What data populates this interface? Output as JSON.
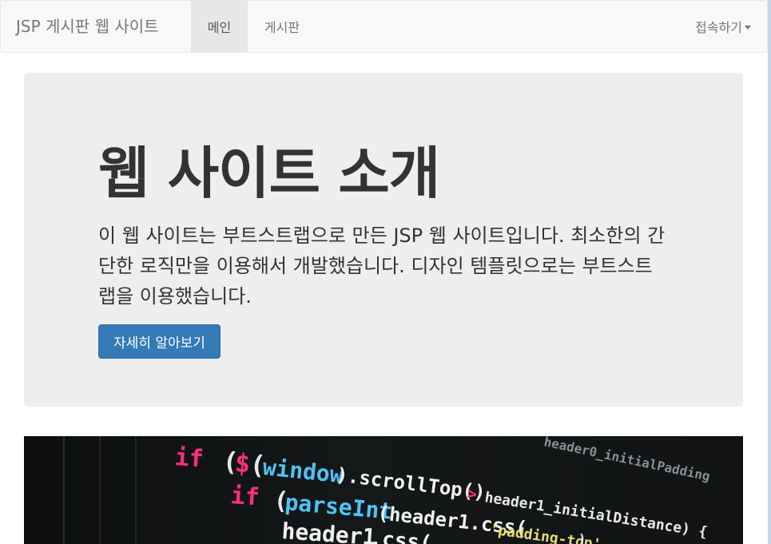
{
  "navbar": {
    "brand": "JSP 게시판 웹 사이트",
    "items": [
      {
        "label": "메인",
        "active": true
      },
      {
        "label": "게시판",
        "active": false
      }
    ],
    "dropdown": {
      "label": "접속하기"
    }
  },
  "jumbotron": {
    "title": "웹 사이트 소개",
    "description": "이 웹 사이트는 부트스트랩으로 만든 JSP 웹 사이트입니다. 최소한의 간단한 로직만을 이용해서 개발했습니다. 디자인 템플릿으로는 부트스트랩을 이용했습니다.",
    "button": "자세히 알아보기"
  },
  "code_image": {
    "lines": [
      {
        "tokens": [
          "if",
          "(",
          "$",
          "(",
          "window",
          ").scrollTop()",
          ">",
          "header1_initialDistance) {"
        ]
      },
      {
        "tokens": [
          "if",
          "(",
          "parseInt",
          "(header1.css(",
          "'padding-top'",
          ")"
        ]
      },
      {
        "tokens": [
          "header1",
          ".css("
        ]
      },
      {
        "tokens": [
          "header0_initialPadding"
        ]
      }
    ]
  },
  "colors": {
    "primary": "#337ab7",
    "navbar_bg": "#f8f8f8",
    "jumbotron_bg": "#eeeeee",
    "active_nav_bg": "#e7e7e7"
  }
}
